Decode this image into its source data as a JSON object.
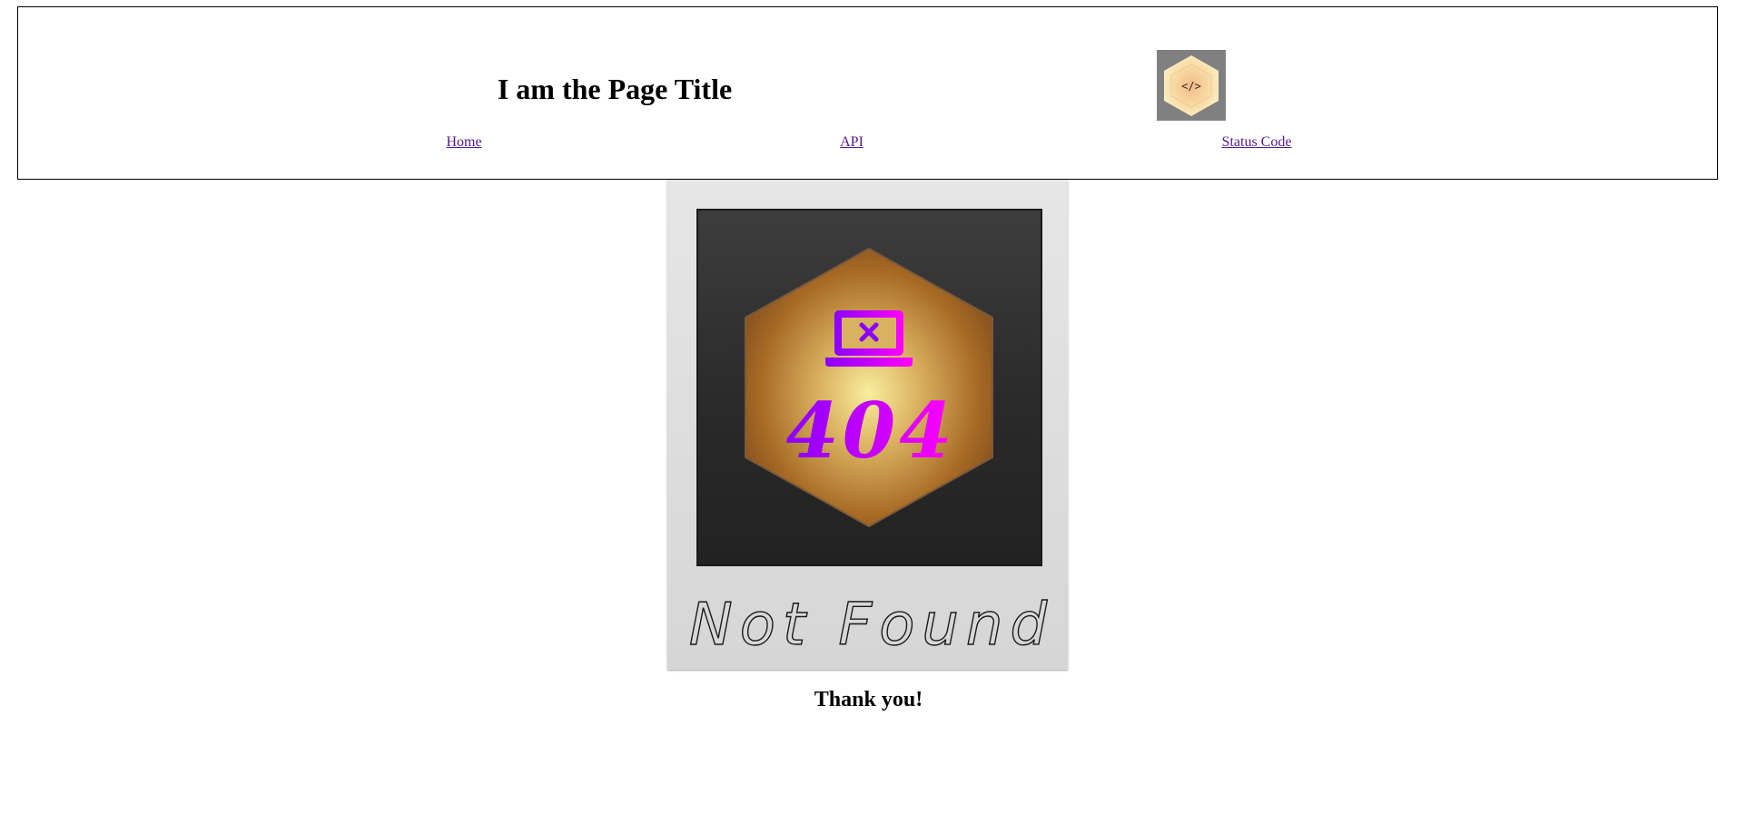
{
  "header": {
    "title": "I am the Page Title",
    "logo_icon": "code-hexagon-icon",
    "logo_glyph": "</>"
  },
  "nav": {
    "items": [
      {
        "label": "Home"
      },
      {
        "label": "API"
      },
      {
        "label": "Status Code"
      }
    ]
  },
  "main": {
    "image": {
      "icon": "laptop-error-icon",
      "code": "404",
      "caption": "Not Found"
    },
    "thanks": "Thank you!"
  },
  "colors": {
    "link": "#551a8b",
    "accent_start": "#8a00ff",
    "accent_end": "#ff00ff",
    "hex_gold": "#b8862e",
    "hex_light": "#f4e8a0"
  }
}
